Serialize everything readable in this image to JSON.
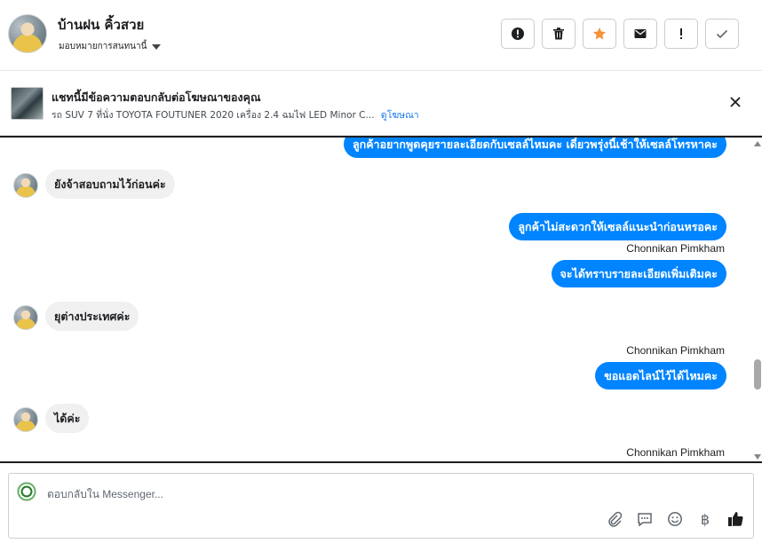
{
  "header": {
    "contact_name": "บ้านฝน คิ้วสวย",
    "assign_label": "มอบหมายการสนทนานี้",
    "actions": [
      {
        "name": "report-spam-button",
        "icon": "alert-circle-icon"
      },
      {
        "name": "delete-button",
        "icon": "trash-icon"
      },
      {
        "name": "star-button",
        "icon": "star-icon"
      },
      {
        "name": "mark-unread-button",
        "icon": "envelope-icon"
      },
      {
        "name": "follow-up-button",
        "icon": "exclamation-icon"
      },
      {
        "name": "mark-done-button",
        "icon": "check-icon"
      }
    ],
    "star_color": "#f7923a"
  },
  "ad_banner": {
    "title": "แชทนี้มีข้อความตอบกลับต่อโฆษณาของคุณ",
    "subtitle": "รถ SUV 7 ที่นั่ง TOYOTA FOUTUNER 2020 เครื่อง 2.4 ฉมไฟ LED Minor C...",
    "link": "ดูโฆษณา"
  },
  "messages": [
    {
      "dir": "out",
      "text": "ลูกค้าอยากพูดคุยรายละเอียดกับเซลล์ไหมคะ เดี๋ยวพรุ่งนี้เช้าให้เซลล์โทรหาคะ"
    },
    {
      "dir": "in",
      "text": "ยังจ้าสอบถามไว้ก่อนค่ะ"
    },
    {
      "dir": "out",
      "text": "ลูกค้าไม่สะดวกให้เซลล์แนะนำก่อนหรอคะ"
    },
    {
      "dir": "sender",
      "text": "Chonnikan Pimkham"
    },
    {
      "dir": "out",
      "text": "จะได้ทราบรายละเอียดเพิ่มเติมคะ"
    },
    {
      "dir": "in",
      "text": "ยุต่างประเทศค่ะ"
    },
    {
      "dir": "sender",
      "text": "Chonnikan Pimkham"
    },
    {
      "dir": "out",
      "text": "ขอแอดไลน์ไว้ได้ไหมคะ"
    },
    {
      "dir": "in",
      "text": "ได้ค่ะ"
    },
    {
      "dir": "sender",
      "text": "Chonnikan Pimkham"
    }
  ],
  "composer": {
    "placeholder": "ตอบกลับใน Messenger...",
    "tools": [
      "paperclip-icon",
      "message-template-icon",
      "emoji-icon",
      "baht-icon",
      "thumbs-up-icon"
    ],
    "baht_symbol": "฿"
  },
  "colors": {
    "outgoing_bubble": "#0084ff",
    "incoming_bubble": "#f0f0f0",
    "link": "#1877f2"
  }
}
